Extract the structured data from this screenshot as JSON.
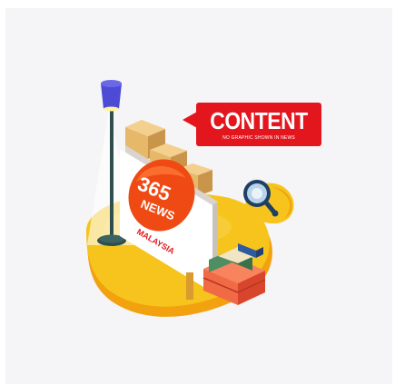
{
  "bubble": {
    "title": "CONTENT",
    "subtitle": "NO GRAPHIC SHOWN IN NEWS"
  },
  "logo": {
    "number": "365",
    "word": "NEWS",
    "country": "MALAYSIA"
  },
  "colors": {
    "background": "#f5f4f6",
    "accent_red": "#e3161d",
    "platform_yellow": "#f6c41c",
    "platform_orange": "#f2a10f",
    "lamp_blue": "#4d4ad6",
    "board_white": "#ffffff",
    "logo_orange": "#f04a14"
  },
  "icons": [
    "floor-lamp-icon",
    "magnifier-badge-icon",
    "book-shelf-icon"
  ]
}
